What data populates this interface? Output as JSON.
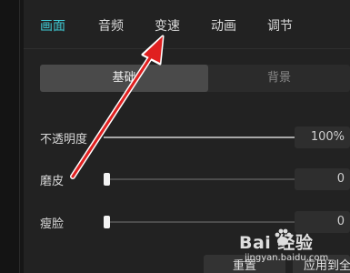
{
  "tabs": [
    {
      "label": "画面"
    },
    {
      "label": "音频"
    },
    {
      "label": "变速"
    },
    {
      "label": "动画"
    },
    {
      "label": "调节"
    }
  ],
  "segment": {
    "basic": "基础",
    "background": "背景"
  },
  "sliders": [
    {
      "label": "不透明度",
      "value": "100%",
      "fraction": 1.0
    },
    {
      "label": "磨皮",
      "value": "0",
      "fraction": 0.0
    },
    {
      "label": "瘦脸",
      "value": "0",
      "fraction": 0.0
    }
  ],
  "buttons": {
    "reset": "重置",
    "apply_all": "应用到全"
  },
  "watermark": {
    "brand": "Bai 经验",
    "url": "jingyan.baidu.com"
  },
  "colors": {
    "accent": "#3fc8d2",
    "arrow": "#e02020"
  }
}
